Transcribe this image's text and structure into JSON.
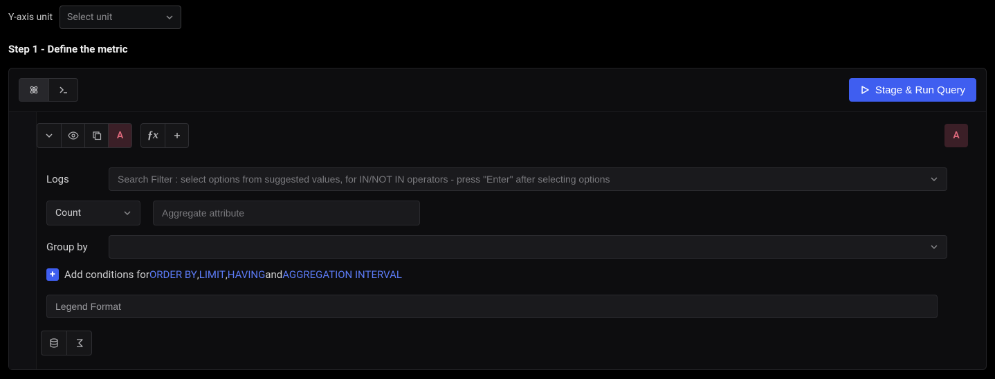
{
  "top": {
    "yAxisLabel": "Y-axis unit",
    "unitPlaceholder": "Select unit"
  },
  "stepTitle": "Step 1 - Define the metric",
  "runButton": "Stage & Run Query",
  "queryBadge": "A",
  "logs": {
    "label": "Logs",
    "filterPlaceholder": "Search Filter : select options from suggested values, for IN/NOT IN operators - press \"Enter\" after selecting options"
  },
  "aggregate": {
    "countLabel": "Count",
    "attrPlaceholder": "Aggregate attribute"
  },
  "groupBy": {
    "label": "Group by"
  },
  "conditions": {
    "prefix": "Add conditions for ",
    "orderBy": "ORDER BY",
    "sep1": ", ",
    "limit": "LIMIT",
    "sep2": ", ",
    "having": "HAVING",
    "and": " and ",
    "aggInterval": "AGGREGATION INTERVAL"
  },
  "legend": {
    "placeholder": "Legend Format"
  }
}
